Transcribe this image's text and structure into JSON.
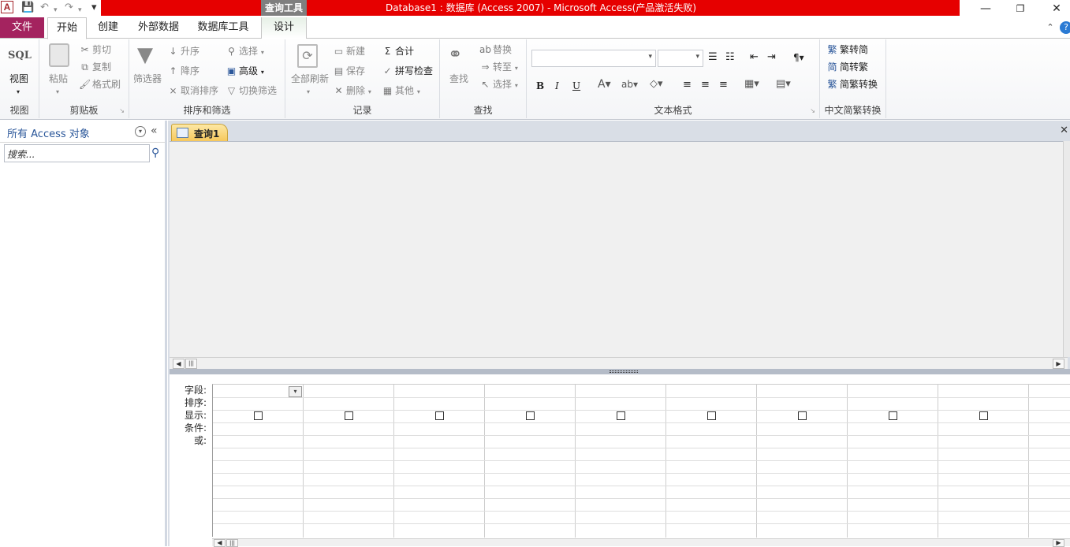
{
  "quick_access": {
    "logo": "A",
    "save": "💾",
    "undo": "↶",
    "redo": "↷",
    "customize": "▾"
  },
  "window": {
    "context_tab": "查询工具",
    "title": "Database1 : 数据库 (Access 2007)  -  Microsoft Access(产品激活失败)",
    "minimize": "—",
    "restore": "❐",
    "close": "✕"
  },
  "tabs": {
    "file": "文件",
    "items": [
      "开始",
      "创建",
      "外部数据",
      "数据库工具",
      "设计"
    ],
    "collapse_icon": "⌃",
    "help_icon": "?"
  },
  "ribbon": {
    "view": {
      "sql": "SQL",
      "label": "视图",
      "group": "视图"
    },
    "clipboard": {
      "paste": "粘贴",
      "cut": "剪切",
      "copy": "复制",
      "format_painter": "格式刷",
      "group": "剪贴板"
    },
    "sort": {
      "filter": "筛选器",
      "asc": "升序",
      "desc": "降序",
      "remove_sort": "取消排序",
      "select": "选择",
      "advanced": "高级",
      "toggle_filter": "切换筛选",
      "group": "排序和筛选"
    },
    "records": {
      "refresh": "全部刷新",
      "new": "新建",
      "save": "保存",
      "delete": "删除",
      "totals": "合计",
      "spelling": "拼写检查",
      "more": "其他",
      "group": "记录"
    },
    "find": {
      "find": "查找",
      "replace": "替换",
      "goto": "转至",
      "select": "选择",
      "group": "查找"
    },
    "text": {
      "bold": "B",
      "italic": "I",
      "underline": "U",
      "group": "文本格式"
    },
    "chinese": {
      "t2s": "繁转简",
      "s2t": "简转繁",
      "convert": "简繁转换",
      "group": "中文简繁转换"
    }
  },
  "nav": {
    "title": "所有 Access 对象",
    "search_placeholder": "搜索..."
  },
  "document": {
    "tab": "查询1"
  },
  "qbe": {
    "labels": [
      "字段:",
      "排序:",
      "显示:",
      "条件:",
      "或:"
    ],
    "columns": 10
  }
}
